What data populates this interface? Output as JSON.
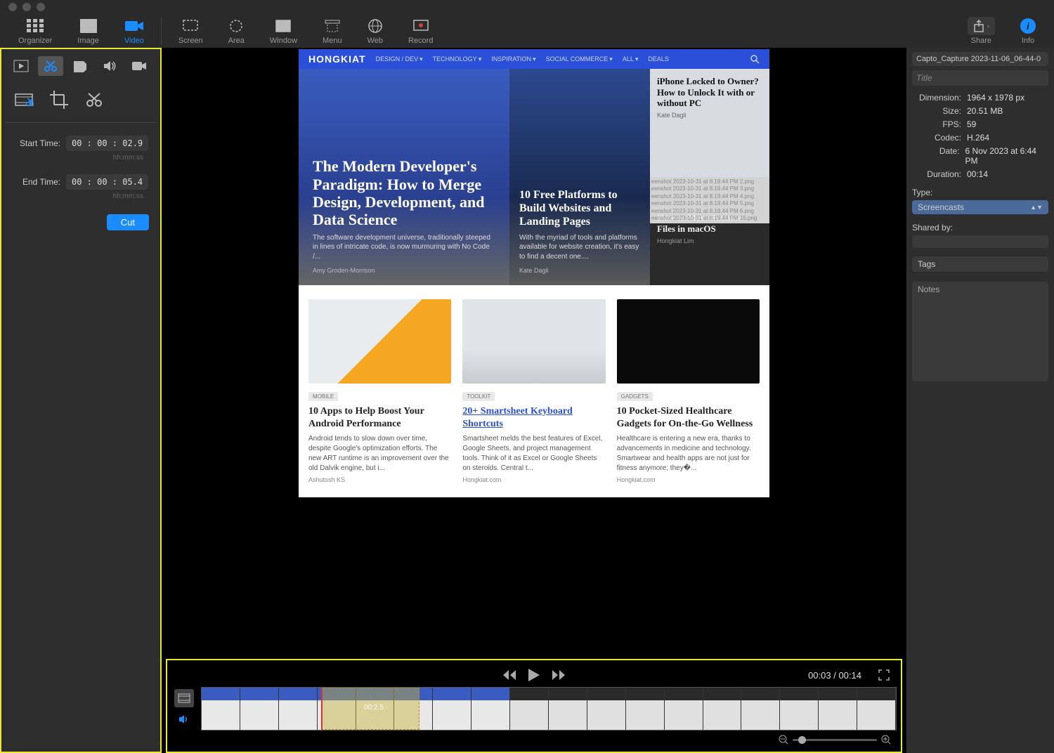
{
  "toolbar": {
    "organizer": "Organizer",
    "image": "Image",
    "video": "Video",
    "screen": "Screen",
    "area": "Area",
    "window": "Window",
    "menu": "Menu",
    "web": "Web",
    "record": "Record",
    "share": "Share",
    "info": "Info"
  },
  "editor": {
    "start_time_label": "Start Time:",
    "start_time_value": "00 : 00 : 02.9",
    "end_time_label": "End Time:",
    "end_time_value": "00 : 00 : 05.4",
    "time_hint": "hh:mm:ss",
    "cut_label": "Cut"
  },
  "preview": {
    "site_logo": "HONGKIAT",
    "nav": [
      "DESIGN / DEV",
      "TECHNOLOGY",
      "INSPIRATION",
      "SOCIAL COMMERCE",
      "ALL",
      "DEALS"
    ],
    "hero1_title": "The Modern Developer's Paradigm: How to Merge Design, Development, and Data Science",
    "hero1_desc": "The software development universe, traditionally steeped in lines of intricate code, is now murmuring with No Code /...",
    "hero1_author": "Amy Groden-Morrison",
    "hero2_title": "10 Free Platforms to Build Websites and Landing Pages",
    "hero2_desc": "With the myriad of tools and platforms available for website creation, it's easy to find a decent one....",
    "hero2_author": "Kate Dagli",
    "hero3a_title": "iPhone Locked to Owner? How to Unlock It with or without PC",
    "hero3a_author": "Kate Dagli",
    "hero3b_title": "How to Mass Rename Files in macOS",
    "hero3b_author": "Hongkiat Lim",
    "files": [
      "eenshot 2023-10-31 at 8.19.44 PM 2.png",
      "eenshot 2023-10-31 at 8.19.44 PM 3.png",
      "eenshot 2023-10-31 at 8.19.44 PM 4.png",
      "eenshot 2023-10-31 at 8.19.44 PM 5.png",
      "eenshot 2023-10-31 at 8.19.44 PM 6.png",
      "eenshot 2023-10-31 at 8.19.44 PM 15.png"
    ],
    "card1_badge": "MOBILE",
    "card1_title": "10 Apps to Help Boost Your Android Performance",
    "card1_desc": "Android tends to slow down over time, despite Google's optimization efforts. The new ART runtime is an improvement over the old Dalvik engine, but i...",
    "card1_src": "Ashutosh KS",
    "card2_badge": "TOOLKIT",
    "card2_title": "20+ Smartsheet Keyboard Shortcuts",
    "card2_desc": "Smartsheet melds the best features of Excel, Google Sheets, and project management tools. Think of it as Excel or Google Sheets on steroids. Central t...",
    "card2_src": "Hongkiat.com",
    "card3_badge": "GADGETS",
    "card3_title": "10 Pocket-Sized Healthcare Gadgets for On-the-Go Wellness",
    "card3_desc": "Healthcare is entering a new era, thanks to advancements in medicine and technology. Smartwear and health apps are not just for fitness anymore; they�...",
    "card3_src": "Hongkiat.com"
  },
  "playback": {
    "current": "00:03",
    "sep": " / ",
    "total": "00:14",
    "selection_label": "00:2.5"
  },
  "info": {
    "filename": "Capto_Capture 2023-11-06_06-44-0",
    "title_placeholder": "Title",
    "dimension_label": "Dimension:",
    "dimension": "1964 x 1978 px",
    "size_label": "Size:",
    "size": "20.51 MB",
    "fps_label": "FPS:",
    "fps": "59",
    "codec_label": "Codec:",
    "codec": "H.264",
    "date_label": "Date:",
    "date": "6 Nov 2023 at 6:44 PM",
    "duration_label": "Duration:",
    "duration": "00:14",
    "type_label": "Type:",
    "type_value": "Screencasts",
    "sharedby_label": "Shared by:",
    "tags_label": "Tags",
    "notes_label": "Notes"
  }
}
